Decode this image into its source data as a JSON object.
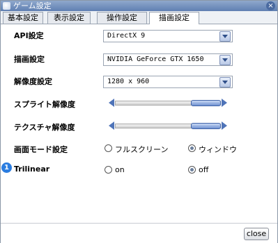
{
  "window": {
    "title": "ゲーム設定",
    "close_glyph": "×"
  },
  "tabs": [
    {
      "label": "基本設定",
      "active": false
    },
    {
      "label": "表示設定",
      "active": false
    },
    {
      "label": "操作設定",
      "active": false
    },
    {
      "label": "描画設定",
      "active": true
    }
  ],
  "settings": {
    "api": {
      "label": "API設定",
      "value": "DirectX 9"
    },
    "renderer": {
      "label": "描画設定",
      "value": "NVIDIA GeForce GTX 1650"
    },
    "resolution": {
      "label": "解像度設定",
      "value": "1280 x 960"
    },
    "sprite_resolution": {
      "label": "スプライト解像度",
      "level_range": [
        0.72,
        0.99
      ]
    },
    "texture_resolution": {
      "label": "テクスチャ解像度",
      "level_range": [
        0.72,
        0.99
      ]
    },
    "screen_mode": {
      "label": "画面モード設定",
      "options": [
        {
          "label": "フルスクリーン",
          "selected": false
        },
        {
          "label": "ウィンドウ",
          "selected": true
        }
      ]
    },
    "trilinear": {
      "badge": "1",
      "label": "Trilinear",
      "options": [
        {
          "label": "on",
          "selected": false
        },
        {
          "label": "off",
          "selected": true
        }
      ]
    }
  },
  "footer": {
    "close_label": "close"
  },
  "colors": {
    "titlebar": "#5f7fb2",
    "accent": "#4f74b8",
    "badge": "#2b7de0"
  }
}
